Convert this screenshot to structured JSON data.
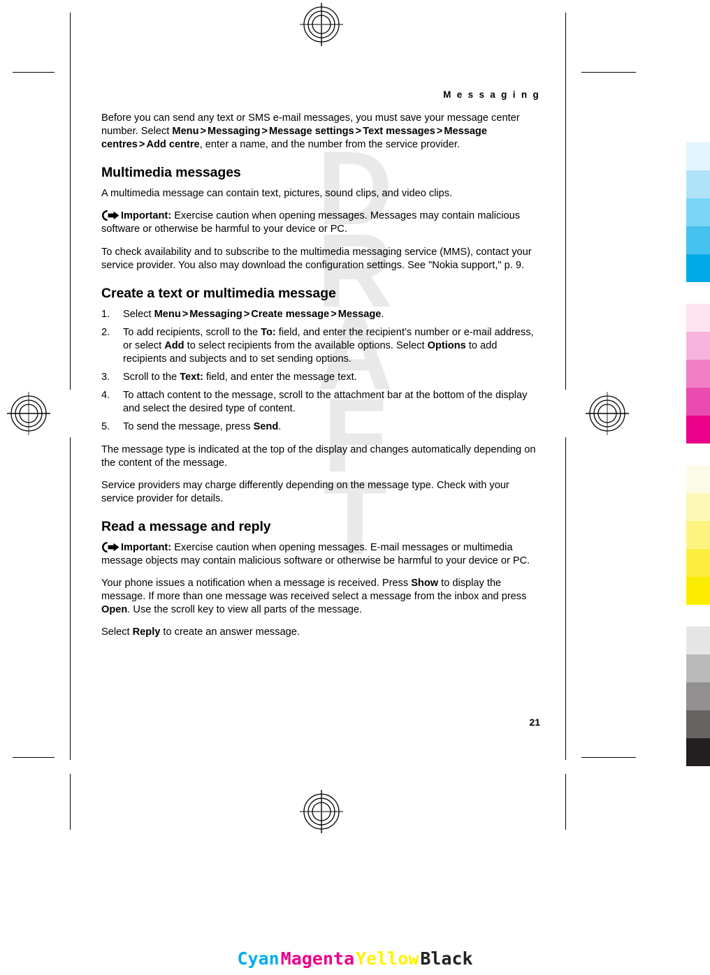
{
  "document": {
    "running_head": "M e s s a g i n g",
    "page_number": "21",
    "watermark": [
      "D",
      "R",
      "A",
      "F",
      "T"
    ]
  },
  "content": {
    "intro": {
      "part1": "Before you can send any text or SMS e-mail messages, you must save your message center number. Select ",
      "menu": "Menu",
      "sep1": ">",
      "messaging": "Messaging",
      "sep2": ">",
      "message_settings": "Message settings",
      "sep3": ">",
      "text_messages": "Text messages",
      "sep4": ">",
      "message_centres": "Message centres",
      "sep5": ">",
      "add_centre": "Add centre",
      "part2": ", enter a name, and the number from the service provider."
    },
    "section_multimedia": {
      "heading": "Multimedia messages",
      "para1": "A multimedia message can contain text, pictures, sound clips, and video clips.",
      "important_label": "Important:",
      "important_text": " Exercise caution when opening messages. Messages may contain malicious software or otherwise be harmful to your device or PC.",
      "para2": "To check availability and to subscribe to the multimedia messaging service (MMS), contact your service provider. You also may download the configuration settings. See \"Nokia support,\" p. 9."
    },
    "section_create": {
      "heading": "Create a text or multimedia message",
      "step1": {
        "prefix": "Select ",
        "menu": "Menu",
        "sep1": ">",
        "messaging": "Messaging",
        "sep2": ">",
        "create_message": "Create message",
        "sep3": ">",
        "message": "Message",
        "suffix": "."
      },
      "step2": {
        "t1": "To add recipients, scroll to the ",
        "b1": "To:",
        "t2": " field, and enter the recipient’s number or e-mail address, or select ",
        "b2": "Add",
        "t3": " to select recipients from the available options. Select ",
        "b3": "Options",
        "t4": " to add recipients and subjects and to set sending options."
      },
      "step3": {
        "t1": "Scroll to the ",
        "b1": "Text:",
        "t2": " field, and enter the message text."
      },
      "step4": {
        "t1": "To attach content to the message, scroll to the attachment bar at the bottom of the display and select the desired type of content."
      },
      "step5": {
        "t1": "To send the message, press ",
        "b1": "Send",
        "t2": "."
      },
      "para1": "The message type is indicated at the top of the display and changes automatically depending on the content of the message.",
      "para2": "Service providers may charge differently depending on the message type. Check with your service provider for details."
    },
    "section_read": {
      "heading": "Read a message and reply",
      "important_label": "Important:",
      "important_text": "  Exercise caution when opening messages. E-mail messages or multimedia message objects may contain malicious software or otherwise be harmful to your device or PC.",
      "para1": {
        "t1": "Your phone issues a notification when a message is received. Press ",
        "b1": "Show",
        "t2": " to display the message. If more than one message was received select a message from the inbox and press ",
        "b2": "Open",
        "t3": ". Use the scroll key to view all parts of the message."
      },
      "para2": {
        "t1": "Select ",
        "b1": "Reply",
        "t2": " to create an answer message."
      }
    }
  },
  "prepress": {
    "color_words": [
      {
        "label": "Cyan",
        "color": "#00AEEF"
      },
      {
        "label": "Magenta",
        "color": "#EC008C"
      },
      {
        "label": "Yellow",
        "color": "#FFF200"
      },
      {
        "label": "Black",
        "color": "#231F20"
      }
    ],
    "color_strip": {
      "cyan": [
        "#E3F4FC",
        "#B0E3F8",
        "#7BD5F5",
        "#45C2F0",
        "#00AAE7"
      ],
      "magenta": [
        "#FBE3F0",
        "#F6B4DC",
        "#F07FC6",
        "#EA4BAE",
        "#EA0089"
      ],
      "yellow": [
        "#FDFCE8",
        "#FCF8B8",
        "#FCF380",
        "#FCEE40",
        "#FCED00"
      ],
      "black": [
        "#E6E6E6",
        "#BCBBBB",
        "#918F8F",
        "#666463",
        "#231F20"
      ]
    }
  }
}
